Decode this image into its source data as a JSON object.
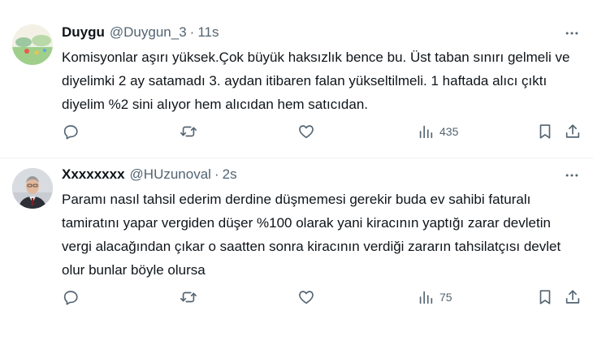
{
  "tweets": [
    {
      "name": "Duygu",
      "handle": "@Duygun_3",
      "separator": "·",
      "time": "11s",
      "text": "Komisyonlar aşırı yüksek.Çok büyük haksızlık bence bu. Üst taban sınırı gelmeli ve diyelimki 2 ay satamadı 3. aydan itibaren falan yükseltilmeli. 1 haftada alıcı çıktı diyelim %2 sini alıyor hem alıcıdan hem satıcıdan.",
      "views": "435"
    },
    {
      "name": "Xxxxxxxx",
      "handle": "@HUzunoval",
      "separator": "·",
      "time": "2s",
      "text": "Paramı nasıl tahsil ederim derdine düşmemesi gerekir buda ev sahibi faturalı tamiratını yapar vergiden düşer %100 olarak yani kiracının yaptığı zarar devletin vergi alacağından çıkar o saatten sonra kiracının verdiği zararın tahsilatçısı devlet olur bunlar böyle olursa",
      "views": "75"
    }
  ],
  "icons": {
    "more": "more-horizontal-icon",
    "reply": "reply-icon",
    "retweet": "retweet-icon",
    "like": "heart-icon",
    "views": "views-chart-icon",
    "bookmark": "bookmark-icon",
    "share": "share-icon"
  },
  "colors": {
    "text": "#0f1419",
    "secondary": "#536471",
    "divider": "#eff3f4"
  }
}
